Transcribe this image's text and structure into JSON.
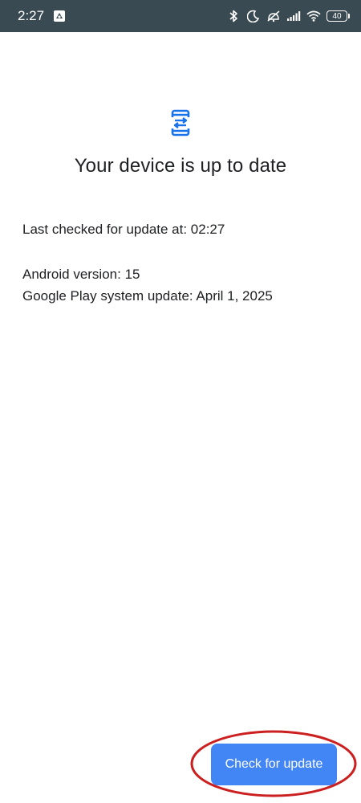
{
  "status_bar": {
    "time": "2:27",
    "battery_level": "40",
    "icons": [
      "app-notification-icon",
      "bluetooth-icon",
      "do-not-disturb-icon",
      "vibrate-off-icon",
      "cell-signal-icon",
      "wifi-icon",
      "battery-icon"
    ]
  },
  "main": {
    "title": "Your device is up to date",
    "last_checked": "Last checked for update at: 02:27",
    "android_version": "Android version: 15",
    "play_system_update": "Google Play system update: April 1, 2025",
    "hero_icon": "phone-sync-icon",
    "accent_color": "#1a73e8"
  },
  "actions": {
    "check_update_label": "Check for update",
    "button_color": "#4285f4",
    "highlight_color": "#cc1f1f"
  }
}
